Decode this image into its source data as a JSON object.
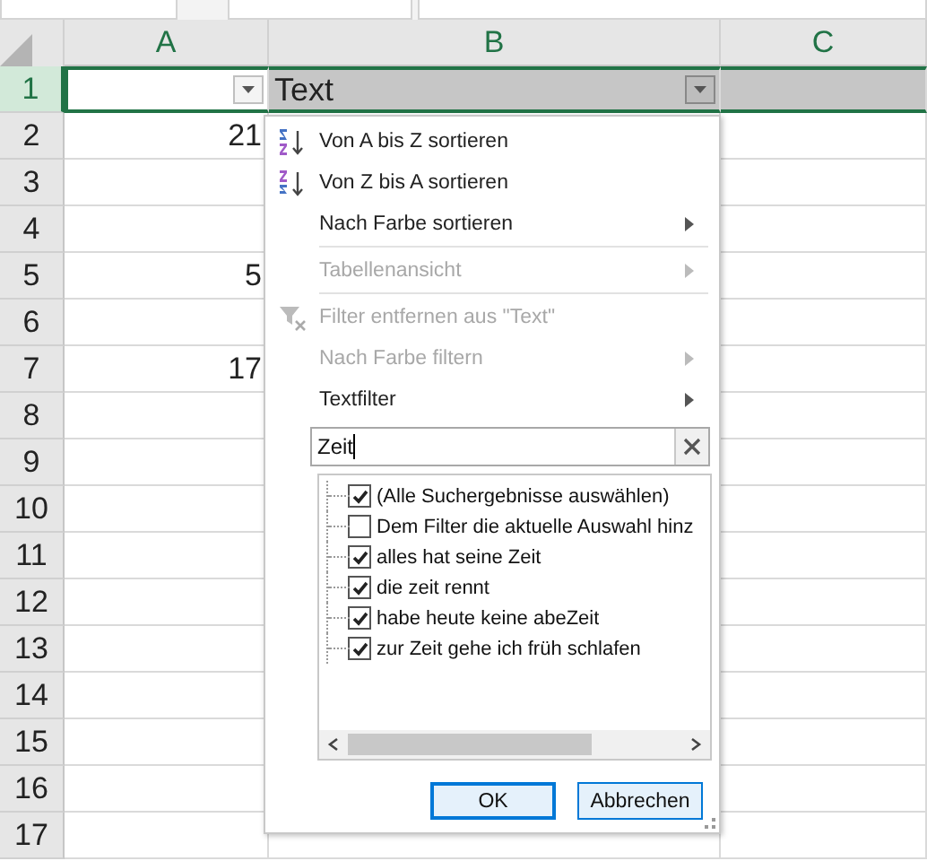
{
  "columns": [
    {
      "label": "A"
    },
    {
      "label": "B"
    },
    {
      "label": "C"
    }
  ],
  "rows": [
    {
      "number": "1",
      "selected": true,
      "cells": [
        {
          "filter": true,
          "active": true
        },
        {
          "value": "Text",
          "filter": true,
          "active": false
        },
        {
          "active": false
        }
      ]
    },
    {
      "number": "2",
      "selected": false,
      "cells": [
        {
          "value": "21"
        }
      ]
    },
    {
      "number": "3",
      "selected": false,
      "cells": []
    },
    {
      "number": "4",
      "selected": false,
      "cells": []
    },
    {
      "number": "5",
      "selected": false,
      "cells": [
        {
          "value": "5"
        }
      ]
    },
    {
      "number": "6",
      "selected": false,
      "cells": []
    },
    {
      "number": "7",
      "selected": false,
      "cells": [
        {
          "value": "17"
        }
      ]
    },
    {
      "number": "8",
      "selected": false,
      "cells": []
    },
    {
      "number": "9",
      "selected": false,
      "cells": []
    },
    {
      "number": "10",
      "selected": false,
      "cells": []
    },
    {
      "number": "11",
      "selected": false,
      "cells": []
    },
    {
      "number": "12",
      "selected": false,
      "cells": []
    },
    {
      "number": "13",
      "selected": false,
      "cells": []
    },
    {
      "number": "14",
      "selected": false,
      "cells": []
    },
    {
      "number": "15",
      "selected": false,
      "cells": []
    },
    {
      "number": "16",
      "selected": false,
      "cells": []
    },
    {
      "number": "17",
      "selected": false,
      "cells": []
    }
  ],
  "filter_menu": {
    "items": [
      {
        "kind": "sort-asc",
        "label": "Von A bis Z sortieren",
        "disabled": false,
        "submenu": false
      },
      {
        "kind": "sort-desc",
        "label": "Von Z bis A sortieren",
        "disabled": false,
        "submenu": false
      },
      {
        "kind": "plain",
        "label": "Nach Farbe sortieren",
        "disabled": false,
        "submenu": true
      },
      {
        "kind": "separator"
      },
      {
        "kind": "plain",
        "label": "Tabellenansicht",
        "disabled": true,
        "submenu": true
      },
      {
        "kind": "separator"
      },
      {
        "kind": "clear-filter",
        "label": "Filter entfernen aus \"Text\"",
        "disabled": true,
        "submenu": false
      },
      {
        "kind": "plain",
        "label": "Nach Farbe filtern",
        "disabled": true,
        "submenu": true
      },
      {
        "kind": "plain",
        "label": "Textfilter",
        "disabled": false,
        "submenu": true
      }
    ],
    "search": {
      "value": "Zeit"
    },
    "values": [
      {
        "label": "(Alle Suchergebnisse auswählen)",
        "checked": true
      },
      {
        "label": "Dem Filter die aktuelle Auswahl hinz",
        "checked": false
      },
      {
        "label": "alles hat seine Zeit",
        "checked": true
      },
      {
        "label": "die zeit rennt",
        "checked": true
      },
      {
        "label": "habe heute keine abeZeit",
        "checked": true
      },
      {
        "label": "zur Zeit gehe ich früh schlafen",
        "checked": true
      }
    ],
    "buttons": [
      {
        "label": "OK",
        "default": true
      },
      {
        "label": "Abbrechen",
        "default": false
      }
    ]
  }
}
